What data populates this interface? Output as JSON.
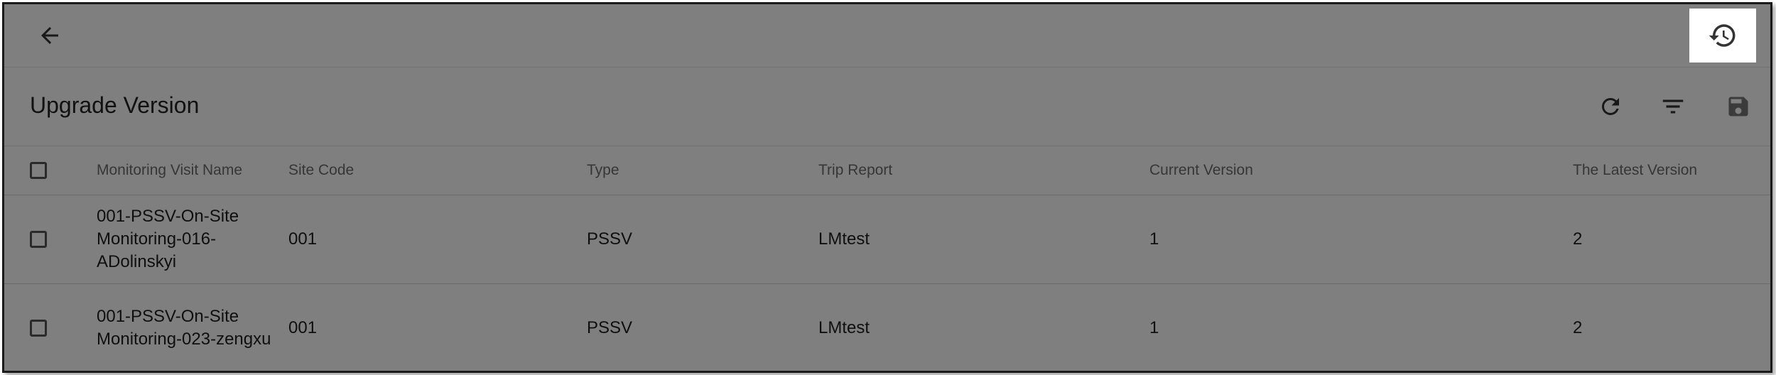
{
  "topbar": {
    "back_icon": "arrow-left-icon",
    "history_icon": "history-icon"
  },
  "panel": {
    "title": "Upgrade Version",
    "toolbar": {
      "refresh_icon": "refresh-icon",
      "filter_icon": "filter-icon",
      "save_icon": "save-icon"
    }
  },
  "table": {
    "columns": [
      "Monitoring Visit Name",
      "Site Code",
      "Type",
      "Trip Report",
      "Current Version",
      "The Latest Version"
    ],
    "rows": [
      {
        "name": "001-PSSV-On-Site Monitoring-016-ADolinskyi",
        "site_code": "001",
        "type": "PSSV",
        "trip_report": "LMtest",
        "current_version": "1",
        "latest_version": "2"
      },
      {
        "name": "001-PSSV-On-Site Monitoring-023-zengxu",
        "site_code": "001",
        "type": "PSSV",
        "trip_report": "LMtest",
        "current_version": "1",
        "latest_version": "2"
      }
    ]
  },
  "colors": {
    "overlay": "#000000",
    "highlight": "#ffffff"
  }
}
